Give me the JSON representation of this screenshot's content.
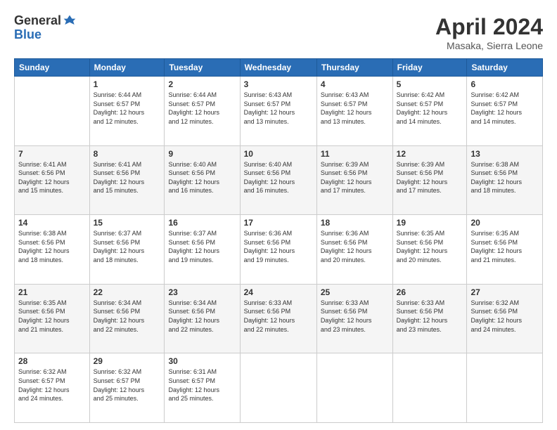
{
  "logo": {
    "general": "General",
    "blue": "Blue"
  },
  "title": "April 2024",
  "subtitle": "Masaka, Sierra Leone",
  "header_days": [
    "Sunday",
    "Monday",
    "Tuesday",
    "Wednesday",
    "Thursday",
    "Friday",
    "Saturday"
  ],
  "weeks": [
    [
      {
        "day": "",
        "info": ""
      },
      {
        "day": "1",
        "info": "Sunrise: 6:44 AM\nSunset: 6:57 PM\nDaylight: 12 hours\nand 12 minutes."
      },
      {
        "day": "2",
        "info": "Sunrise: 6:44 AM\nSunset: 6:57 PM\nDaylight: 12 hours\nand 12 minutes."
      },
      {
        "day": "3",
        "info": "Sunrise: 6:43 AM\nSunset: 6:57 PM\nDaylight: 12 hours\nand 13 minutes."
      },
      {
        "day": "4",
        "info": "Sunrise: 6:43 AM\nSunset: 6:57 PM\nDaylight: 12 hours\nand 13 minutes."
      },
      {
        "day": "5",
        "info": "Sunrise: 6:42 AM\nSunset: 6:57 PM\nDaylight: 12 hours\nand 14 minutes."
      },
      {
        "day": "6",
        "info": "Sunrise: 6:42 AM\nSunset: 6:57 PM\nDaylight: 12 hours\nand 14 minutes."
      }
    ],
    [
      {
        "day": "7",
        "info": "Sunrise: 6:41 AM\nSunset: 6:56 PM\nDaylight: 12 hours\nand 15 minutes."
      },
      {
        "day": "8",
        "info": "Sunrise: 6:41 AM\nSunset: 6:56 PM\nDaylight: 12 hours\nand 15 minutes."
      },
      {
        "day": "9",
        "info": "Sunrise: 6:40 AM\nSunset: 6:56 PM\nDaylight: 12 hours\nand 16 minutes."
      },
      {
        "day": "10",
        "info": "Sunrise: 6:40 AM\nSunset: 6:56 PM\nDaylight: 12 hours\nand 16 minutes."
      },
      {
        "day": "11",
        "info": "Sunrise: 6:39 AM\nSunset: 6:56 PM\nDaylight: 12 hours\nand 17 minutes."
      },
      {
        "day": "12",
        "info": "Sunrise: 6:39 AM\nSunset: 6:56 PM\nDaylight: 12 hours\nand 17 minutes."
      },
      {
        "day": "13",
        "info": "Sunrise: 6:38 AM\nSunset: 6:56 PM\nDaylight: 12 hours\nand 18 minutes."
      }
    ],
    [
      {
        "day": "14",
        "info": "Sunrise: 6:38 AM\nSunset: 6:56 PM\nDaylight: 12 hours\nand 18 minutes."
      },
      {
        "day": "15",
        "info": "Sunrise: 6:37 AM\nSunset: 6:56 PM\nDaylight: 12 hours\nand 18 minutes."
      },
      {
        "day": "16",
        "info": "Sunrise: 6:37 AM\nSunset: 6:56 PM\nDaylight: 12 hours\nand 19 minutes."
      },
      {
        "day": "17",
        "info": "Sunrise: 6:36 AM\nSunset: 6:56 PM\nDaylight: 12 hours\nand 19 minutes."
      },
      {
        "day": "18",
        "info": "Sunrise: 6:36 AM\nSunset: 6:56 PM\nDaylight: 12 hours\nand 20 minutes."
      },
      {
        "day": "19",
        "info": "Sunrise: 6:35 AM\nSunset: 6:56 PM\nDaylight: 12 hours\nand 20 minutes."
      },
      {
        "day": "20",
        "info": "Sunrise: 6:35 AM\nSunset: 6:56 PM\nDaylight: 12 hours\nand 21 minutes."
      }
    ],
    [
      {
        "day": "21",
        "info": "Sunrise: 6:35 AM\nSunset: 6:56 PM\nDaylight: 12 hours\nand 21 minutes."
      },
      {
        "day": "22",
        "info": "Sunrise: 6:34 AM\nSunset: 6:56 PM\nDaylight: 12 hours\nand 22 minutes."
      },
      {
        "day": "23",
        "info": "Sunrise: 6:34 AM\nSunset: 6:56 PM\nDaylight: 12 hours\nand 22 minutes."
      },
      {
        "day": "24",
        "info": "Sunrise: 6:33 AM\nSunset: 6:56 PM\nDaylight: 12 hours\nand 22 minutes."
      },
      {
        "day": "25",
        "info": "Sunrise: 6:33 AM\nSunset: 6:56 PM\nDaylight: 12 hours\nand 23 minutes."
      },
      {
        "day": "26",
        "info": "Sunrise: 6:33 AM\nSunset: 6:56 PM\nDaylight: 12 hours\nand 23 minutes."
      },
      {
        "day": "27",
        "info": "Sunrise: 6:32 AM\nSunset: 6:56 PM\nDaylight: 12 hours\nand 24 minutes."
      }
    ],
    [
      {
        "day": "28",
        "info": "Sunrise: 6:32 AM\nSunset: 6:57 PM\nDaylight: 12 hours\nand 24 minutes."
      },
      {
        "day": "29",
        "info": "Sunrise: 6:32 AM\nSunset: 6:57 PM\nDaylight: 12 hours\nand 25 minutes."
      },
      {
        "day": "30",
        "info": "Sunrise: 6:31 AM\nSunset: 6:57 PM\nDaylight: 12 hours\nand 25 minutes."
      },
      {
        "day": "",
        "info": ""
      },
      {
        "day": "",
        "info": ""
      },
      {
        "day": "",
        "info": ""
      },
      {
        "day": "",
        "info": ""
      }
    ]
  ]
}
